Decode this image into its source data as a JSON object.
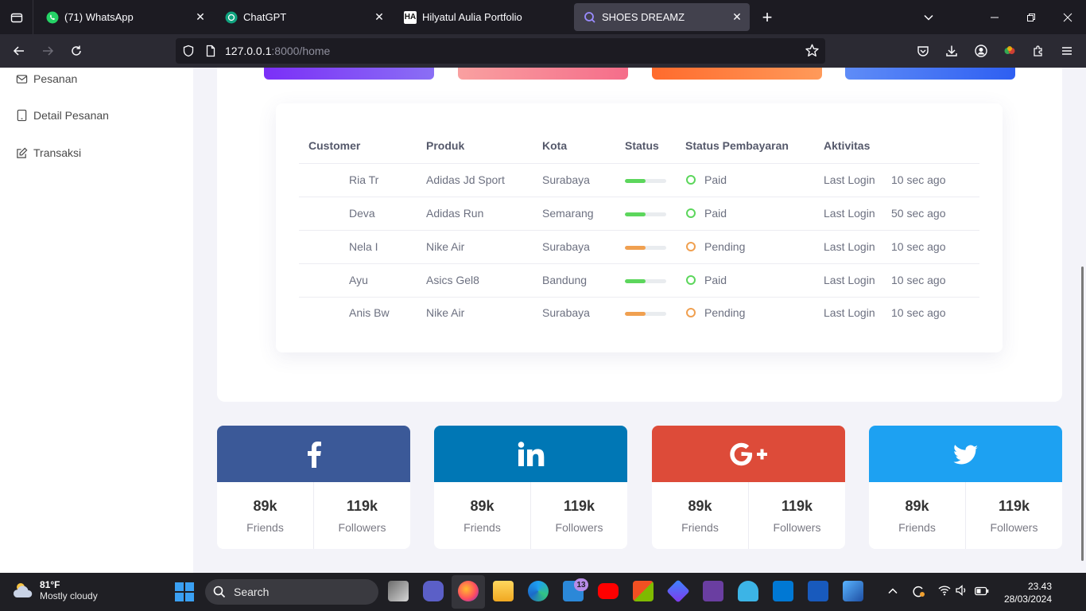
{
  "browser": {
    "tabs": [
      {
        "title": "(71) WhatsApp"
      },
      {
        "title": "ChatGPT"
      },
      {
        "title": "Hilyatul Aulia Portfolio"
      },
      {
        "title": "SHOES DREAMZ"
      }
    ],
    "url_host": "127.0.0.1",
    "url_rest": ":8000/home"
  },
  "sidebar": {
    "items": [
      {
        "label": "Pesanan",
        "icon": "mail-icon"
      },
      {
        "label": "Detail Pesanan",
        "icon": "tablet-icon"
      },
      {
        "label": "Transaksi",
        "icon": "edit-icon"
      }
    ]
  },
  "stat_bars": [
    {
      "color": "#7b3ff2"
    },
    {
      "color": "#f77a8a"
    },
    {
      "color": "#ff7a3d"
    },
    {
      "color": "#3b6ff5"
    }
  ],
  "orders_table": {
    "headers": [
      "Customer",
      "Produk",
      "Kota",
      "Status",
      "Status Pembayaran",
      "Aktivitas"
    ],
    "rows": [
      {
        "customer": "Ria Tr",
        "product": "Adidas Jd Sport",
        "city": "Surabaya",
        "progress": 0.5,
        "status_color": "#5cd65c",
        "payment": "Paid",
        "activity": "Last Login",
        "time": "10 sec ago"
      },
      {
        "customer": "Deva",
        "product": "Adidas Run",
        "city": "Semarang",
        "progress": 0.5,
        "status_color": "#5cd65c",
        "payment": "Paid",
        "activity": "Last Login",
        "time": "50 sec ago"
      },
      {
        "customer": "Nela I",
        "product": "Nike Air",
        "city": "Surabaya",
        "progress": 0.5,
        "status_color": "#f0a050",
        "payment": "Pending",
        "activity": "Last Login",
        "time": "10 sec ago"
      },
      {
        "customer": "Ayu",
        "product": "Asics Gel8",
        "city": "Bandung",
        "progress": 0.5,
        "status_color": "#5cd65c",
        "payment": "Paid",
        "activity": "Last Login",
        "time": "10 sec ago"
      },
      {
        "customer": "Anis Bw",
        "product": "Nike Air",
        "city": "Surabaya",
        "progress": 0.5,
        "status_color": "#f0a050",
        "payment": "Pending",
        "activity": "Last Login",
        "time": "10 sec ago"
      }
    ]
  },
  "social": [
    {
      "network": "facebook",
      "icon": "facebook-icon",
      "color": "#3b5998",
      "friends": "89k",
      "friends_label": "Friends",
      "followers": "119k",
      "followers_label": "Followers"
    },
    {
      "network": "linkedin",
      "icon": "linkedin-icon",
      "color": "#0077b5",
      "friends": "89k",
      "friends_label": "Friends",
      "followers": "119k",
      "followers_label": "Followers"
    },
    {
      "network": "google-plus",
      "icon": "google-plus-icon",
      "color": "#dd4b39",
      "friends": "89k",
      "friends_label": "Friends",
      "followers": "119k",
      "followers_label": "Followers"
    },
    {
      "network": "twitter",
      "icon": "twitter-icon",
      "color": "#1da1f2",
      "friends": "89k",
      "friends_label": "Friends",
      "followers": "119k",
      "followers_label": "Followers"
    }
  ],
  "taskbar": {
    "weather_temp": "81°F",
    "weather_desc": "Mostly cloudy",
    "search_placeholder": "Search",
    "mail_badge": "13",
    "time": "23.43",
    "date": "28/03/2024"
  }
}
